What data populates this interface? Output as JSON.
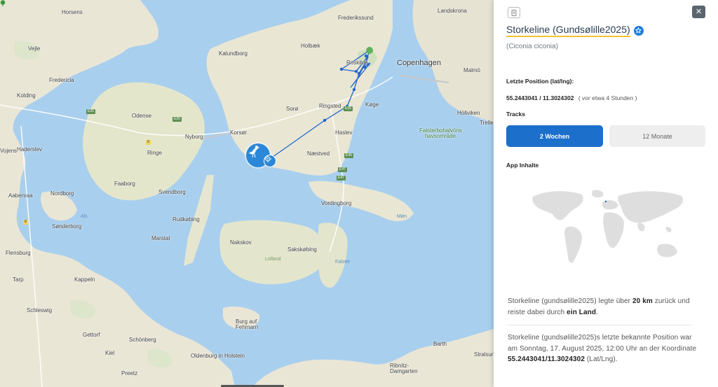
{
  "map": {
    "places": [
      {
        "name": "Horsens",
        "cls": "",
        "key": "horsens"
      },
      {
        "name": "Vejle",
        "cls": "",
        "key": "vejle"
      },
      {
        "name": "Fredericia",
        "cls": "",
        "key": "fredericia"
      },
      {
        "name": "Kolding",
        "cls": "",
        "key": "kolding"
      },
      {
        "name": "Haderslev",
        "cls": "",
        "key": "haderslev"
      },
      {
        "name": "Vojens",
        "cls": "",
        "key": "vojens"
      },
      {
        "name": "Aabenraa",
        "cls": "",
        "key": "aabenraa"
      },
      {
        "name": "Nordborg",
        "cls": "",
        "key": "nordborg"
      },
      {
        "name": "Sønderborg",
        "cls": "",
        "key": "sonderborg"
      },
      {
        "name": "Flensburg",
        "cls": "",
        "key": "flensburg"
      },
      {
        "name": "Tarp",
        "cls": "",
        "key": "tarp"
      },
      {
        "name": "Schleswig",
        "cls": "",
        "key": "schleswig"
      },
      {
        "name": "Kappeln",
        "cls": "",
        "key": "kappeln"
      },
      {
        "name": "Gettorf",
        "cls": "",
        "key": "gettorf"
      },
      {
        "name": "Kiel",
        "cls": "",
        "key": "kiel"
      },
      {
        "name": "Schönberg",
        "cls": "",
        "key": "schonberg"
      },
      {
        "name": "Preetz",
        "cls": "",
        "key": "preetz"
      },
      {
        "name": "Oldenburg in Holstein",
        "cls": "",
        "key": "oldenburg"
      },
      {
        "name": "Burg auf Fehmarn",
        "cls": "",
        "key": "burg"
      },
      {
        "name": "Odense",
        "cls": "",
        "key": "odense"
      },
      {
        "name": "Nyborg",
        "cls": "",
        "key": "nyborg"
      },
      {
        "name": "Ringe",
        "cls": "",
        "key": "ringe"
      },
      {
        "name": "Faaborg",
        "cls": "",
        "key": "faaborg"
      },
      {
        "name": "Svendborg",
        "cls": "",
        "key": "svendborg"
      },
      {
        "name": "Rudkøbing",
        "cls": "",
        "key": "rudkobing"
      },
      {
        "name": "Marstal",
        "cls": "",
        "key": "marstal"
      },
      {
        "name": "Als",
        "cls": "water",
        "key": "als"
      },
      {
        "name": "Kalundborg",
        "cls": "",
        "key": "kalundborg"
      },
      {
        "name": "Holbæk",
        "cls": "",
        "key": "holbaek"
      },
      {
        "name": "Frederikssund",
        "cls": "",
        "key": "frederikssund"
      },
      {
        "name": "Roskilde",
        "cls": "",
        "key": "roskilde"
      },
      {
        "name": "Copenhagen",
        "cls": "city",
        "key": "copenhagen"
      },
      {
        "name": "Malmö",
        "cls": "",
        "key": "malmo"
      },
      {
        "name": "Landskrona",
        "cls": "",
        "key": "landskrona"
      },
      {
        "name": "Sorø",
        "cls": "",
        "key": "soro"
      },
      {
        "name": "Ringsted",
        "cls": "",
        "key": "ringsted"
      },
      {
        "name": "Køge",
        "cls": "",
        "key": "koge"
      },
      {
        "name": "Korsør",
        "cls": "",
        "key": "korsor"
      },
      {
        "name": "Haslev",
        "cls": "",
        "key": "haslev"
      },
      {
        "name": "Næstved",
        "cls": "",
        "key": "naestved"
      },
      {
        "name": "Vordingborg",
        "cls": "",
        "key": "vordingborg"
      },
      {
        "name": "Nakskov",
        "cls": "",
        "key": "nakskov"
      },
      {
        "name": "Sakskøbing",
        "cls": "",
        "key": "sakskobing"
      },
      {
        "name": "Lolland",
        "cls": "islandname",
        "key": "lolland"
      },
      {
        "name": "Falster",
        "cls": "water",
        "key": "falster"
      },
      {
        "name": "Møn",
        "cls": "water",
        "key": "mon"
      },
      {
        "name": "Höllviken",
        "cls": "",
        "key": "hollviken"
      },
      {
        "name": "Trelleborg",
        "cls": "",
        "key": "trelle"
      },
      {
        "name": "Falsterbohalvöns havsområde",
        "cls": "",
        "key": "falsterbo"
      },
      {
        "name": "Barth",
        "cls": "",
        "key": "barth"
      },
      {
        "name": "Stralsund",
        "cls": "",
        "key": "stralsund"
      },
      {
        "name": "Ribnitz-Damgarten",
        "cls": "",
        "key": "ribnitz"
      }
    ],
    "shields": [
      "E20",
      "E20",
      "E45",
      "E47",
      "E47",
      "E55",
      "9",
      "8"
    ]
  },
  "panel": {
    "title": "Storkeline (Gundsølille2025)",
    "subtitle": "(Ciconia ciconia)",
    "last_position_label": "Letzte Position (lat/lng):",
    "coords": "55.2443041 / 11.3024302",
    "coords_ago": "( vor etwa 4 Stunden )",
    "tracks_label": "Tracks",
    "track_active": "2 Wochen",
    "track_inactive": "12 Monate",
    "app_content_label": "App Inhalte",
    "summary": {
      "prefix": "Storkeline (gundsølille2025) legte über ",
      "distance": "20 km",
      "middle": " zurück und reiste dabei durch ",
      "countries": "ein Land",
      "suffix": "."
    },
    "last_known": {
      "prefix": "Storkeline (gundsølille2025)s letzte bekannte Position war am Sonntag, 17. August 2025, 12:00 Uhr an der Koordinate ",
      "coords": "55.2443041/11.3024302",
      "suffix": " (Lat/Lng)."
    },
    "colors": {
      "accent": "#1c6fcb",
      "underline": "#f2c230",
      "track_line": "#2266cc"
    }
  }
}
